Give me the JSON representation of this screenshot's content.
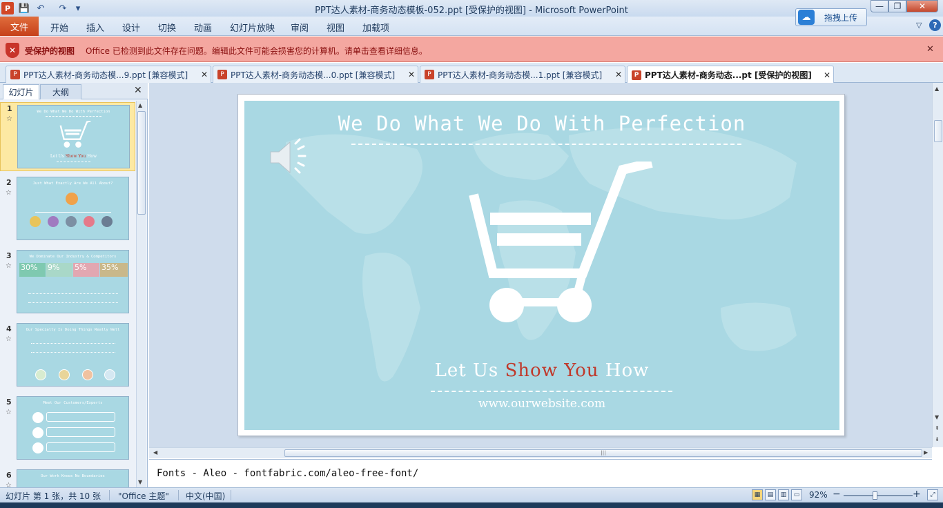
{
  "window": {
    "title": "PPT达人素材-商务动态模板-052.ppt [受保护的视图]  -  Microsoft PowerPoint",
    "cloud_button": "拖拽上传",
    "minimize": "—",
    "maximize": "❐",
    "close": "✕"
  },
  "quick_access": {
    "app": "P",
    "save": "💾",
    "undo": "↶",
    "redo": "↷",
    "customize": "▾"
  },
  "ribbon": {
    "file": "文件",
    "tabs": [
      "开始",
      "插入",
      "设计",
      "切换",
      "动画",
      "幻灯片放映",
      "审阅",
      "视图",
      "加载项"
    ]
  },
  "protected_bar": {
    "title": "受保护的视图",
    "message": "Office 已检测到此文件存在问题。编辑此文件可能会损害您的计算机。请单击查看详细信息。"
  },
  "doc_tabs": [
    {
      "label": "PPT达人素材-商务动态模...9.ppt [兼容模式]"
    },
    {
      "label": "PPT达人素材-商务动态模...0.ppt [兼容模式]"
    },
    {
      "label": "PPT达人素材-商务动态模...1.ppt [兼容模式]"
    },
    {
      "label": "PPT达人素材-商务动态...pt [受保护的视图]"
    }
  ],
  "pane": {
    "slides_tab": "幻灯片",
    "outline_tab": "大纲",
    "close": "✕"
  },
  "thumbnails": [
    {
      "num": "1",
      "title": "We Do What We Do With Perfection"
    },
    {
      "num": "2",
      "title": "Just What Exactly Are We All About?"
    },
    {
      "num": "3",
      "title": "We Dominate Our Industry & Competitors"
    },
    {
      "num": "4",
      "title": "Our Specialty Is Doing Things Really Well"
    },
    {
      "num": "5",
      "title": "Meet Our Customers/Experts"
    },
    {
      "num": "6",
      "title": "Our Work Knows No Boundaries"
    }
  ],
  "thumb3_stats": [
    "30%",
    "9%",
    "5%",
    "35%"
  ],
  "slide": {
    "title": "We Do What We Do With Perfection",
    "tagline_1": "Let Us ",
    "tagline_hl": "Show You",
    "tagline_2": " How",
    "website": "www.ourwebsite.com"
  },
  "notes": "Fonts - Aleo - fontfabric.com/aleo-free-font/",
  "status": {
    "slide_info": "幻灯片 第 1 张，共 10 张",
    "theme": "\"Office 主题\"",
    "language": "中文(中国)",
    "zoom": "92%",
    "zoom_out": "−",
    "zoom_in": "+"
  },
  "colors": {
    "accent": "#c6401a",
    "slide_bg": "#a9d8e3",
    "highlight": "#c0392b",
    "protected_bar": "#f4a7a0"
  }
}
